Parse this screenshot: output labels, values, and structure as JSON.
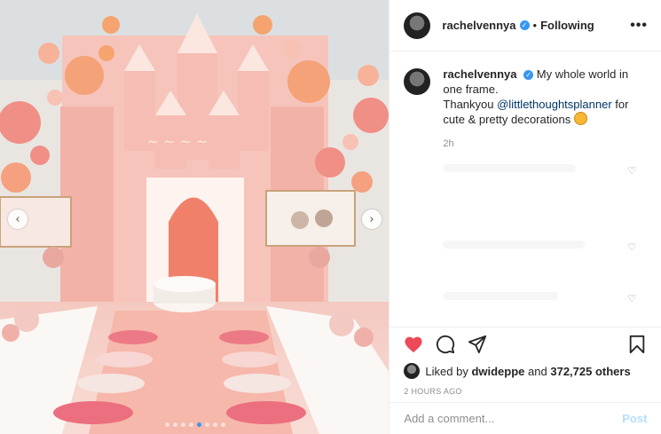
{
  "post": {
    "username": "rachelvennya",
    "follow_label": "Following",
    "separator": "•",
    "more_label": "•••"
  },
  "caption": {
    "username": "rachelvennya",
    "text_before": "My whole world in one frame.",
    "text_mid": "Thankyou ",
    "mention": "@littlethoughtsplanner",
    "text_after": " for cute & pretty decorations",
    "time": "2h"
  },
  "media": {
    "prev_icon": "chevron-left-icon",
    "next_icon": "chevron-right-icon",
    "prev_glyph": "‹",
    "next_glyph": "›",
    "dots": 8,
    "active_dot": 4
  },
  "actions": {
    "liked_prefix": "Liked by ",
    "liked_user": "dwideppe",
    "liked_mid": " and ",
    "liked_count": "372,725 others",
    "timestamp": "2 HOURS AGO"
  },
  "comment_box": {
    "placeholder": "Add a comment...",
    "post_label": "Post"
  },
  "colors": {
    "like_red": "#ed4956",
    "link_blue": "#3897f0",
    "post_disabled": "#b2dffc"
  }
}
